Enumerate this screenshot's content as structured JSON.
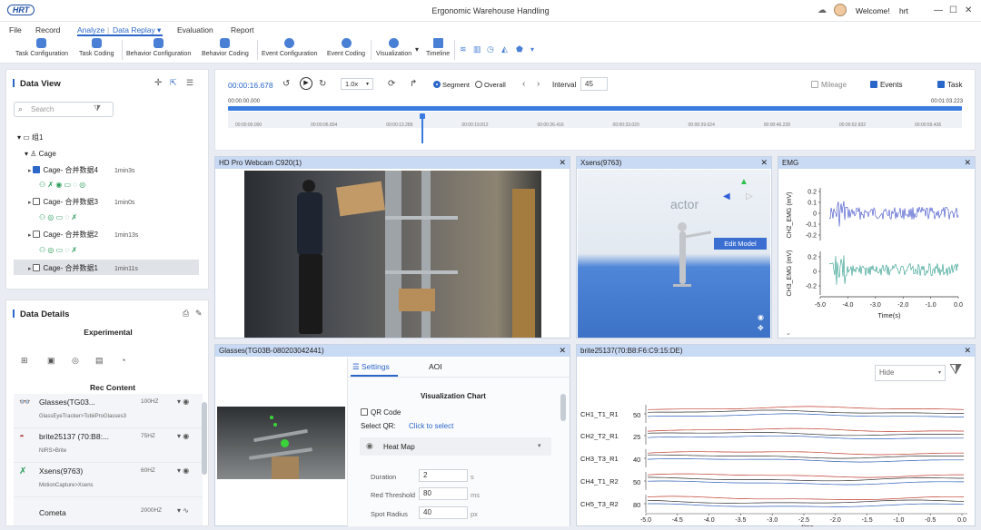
{
  "app": {
    "logo": "HRT",
    "title": "Ergonomic Warehouse Handling",
    "welcome": "Welcome!",
    "user": "hrt"
  },
  "menu": {
    "file": "File",
    "record": "Record",
    "analyze": "Analyze",
    "data_replay": "Data Replay",
    "evaluation": "Evaluation",
    "report": "Report"
  },
  "toolbar": {
    "task_configuration": "Task Configuration",
    "task_coding": "Task Coding",
    "behavior_configuration": "Behavior Configuration",
    "behavior_coding": "Behavior Coding",
    "event_configuration": "Event Configuration",
    "event_coding": "Event Coding",
    "visualization": "Visualization",
    "timeline": "Timeline"
  },
  "data_view": {
    "title": "Data View",
    "search_placeholder": "Search",
    "group": "组1",
    "subgroup": "Cage",
    "items": [
      {
        "label": "Cage- 合并数据4",
        "duration": "1min3s"
      },
      {
        "label": "Cage- 合并数据3",
        "duration": "1min0s"
      },
      {
        "label": "Cage- 合并数据2",
        "duration": "1min13s"
      },
      {
        "label": "Cage- 合并数据1",
        "duration": "1min11s"
      }
    ]
  },
  "data_details": {
    "title": "Data Details",
    "experimental": "Experimental",
    "rec_content": "Rec Content",
    "devices": [
      {
        "name": "Glasses(TG03...",
        "sub": "GlassEyeTracker>TobiiProGlasses3",
        "hz": "100HZ"
      },
      {
        "name": "brite25137 (70:B8:...",
        "sub": "NIRS>Brite",
        "hz": "75HZ"
      },
      {
        "name": "Xsens(9763)",
        "sub": "MotionCapture>Xsens",
        "hz": "60HZ"
      },
      {
        "name": "Cometa",
        "sub": "",
        "hz": "2000HZ"
      }
    ]
  },
  "playback": {
    "time": "00:00:16.678",
    "speed": "1.0x",
    "segment": "Segment",
    "overall": "Overall",
    "interval_label": "Interval",
    "interval_value": "45",
    "mileage": "Mileage",
    "events": "Events",
    "task": "Task",
    "start_time": "00:00:00.000",
    "end_time": "00:01:03.223",
    "ticks": [
      "00:00:00.000",
      "00:00:06.804",
      "00:00:13.289",
      "00:00:19.812",
      "00:00:26.416",
      "00:00:33.020",
      "00:00:39.624",
      "00:00:46.228",
      "00:00:52.832",
      "00:00:59.436"
    ],
    "progress": 0.264
  },
  "panels": {
    "webcam": "HD Pro Webcam C920(1)",
    "xsens": "Xsens(9763)",
    "xsens_actor": "actor",
    "xsens_edit": "Edit Model",
    "emg": "EMG",
    "glasses": "Glasses(TG03B-080203042441)",
    "brite": "brite25137(70:B8:F6:C9:15:DE)"
  },
  "emg_chart": {
    "ylabel1": "CH2_EMG (mV)",
    "ylabel2": "CH3_EMG (mV)",
    "yticks1": [
      "0.2",
      "0.1",
      "0",
      "-0.1",
      "-0.2"
    ],
    "yticks2": [
      "0.2",
      "0",
      "-0.2"
    ],
    "xticks": [
      "-5.0",
      "-4.0",
      "-3.0",
      "-2.0",
      "-1.0",
      "0.0"
    ],
    "xlabel": "Time(s)"
  },
  "glasses_settings": {
    "tab_settings": "Settings",
    "tab_aoi": "AOI",
    "vis_chart": "Visualization Chart",
    "qr_code": "QR Code",
    "select_qr": "Select QR:",
    "click_to_select": "Click to select",
    "heat_map": "Heat Map",
    "duration_label": "Duration",
    "duration_value": "2",
    "duration_unit": "s",
    "red_threshold_label": "Red Threshold",
    "red_threshold_value": "80",
    "red_threshold_unit": "ms",
    "spot_radius_label": "Spot Radius",
    "spot_radius_value": "40",
    "spot_radius_unit": "px"
  },
  "brite_chart": {
    "hide": "Hide",
    "channels": [
      {
        "name": "CH1_T1_R1",
        "tick": "50"
      },
      {
        "name": "CH2_T2_R1",
        "tick": "25"
      },
      {
        "name": "CH3_T3_R1",
        "tick": "40"
      },
      {
        "name": "CH4_T1_R2",
        "tick": "50"
      },
      {
        "name": "CH5_T3_R2",
        "tick": "80"
      }
    ],
    "xticks": [
      "-5.0",
      "-4.5",
      "-4.0",
      "-3.5",
      "-3.0",
      "-2.5",
      "-2.0",
      "-1.5",
      "-1.0",
      "-0.5",
      "0.0"
    ],
    "xlabel": "time"
  }
}
